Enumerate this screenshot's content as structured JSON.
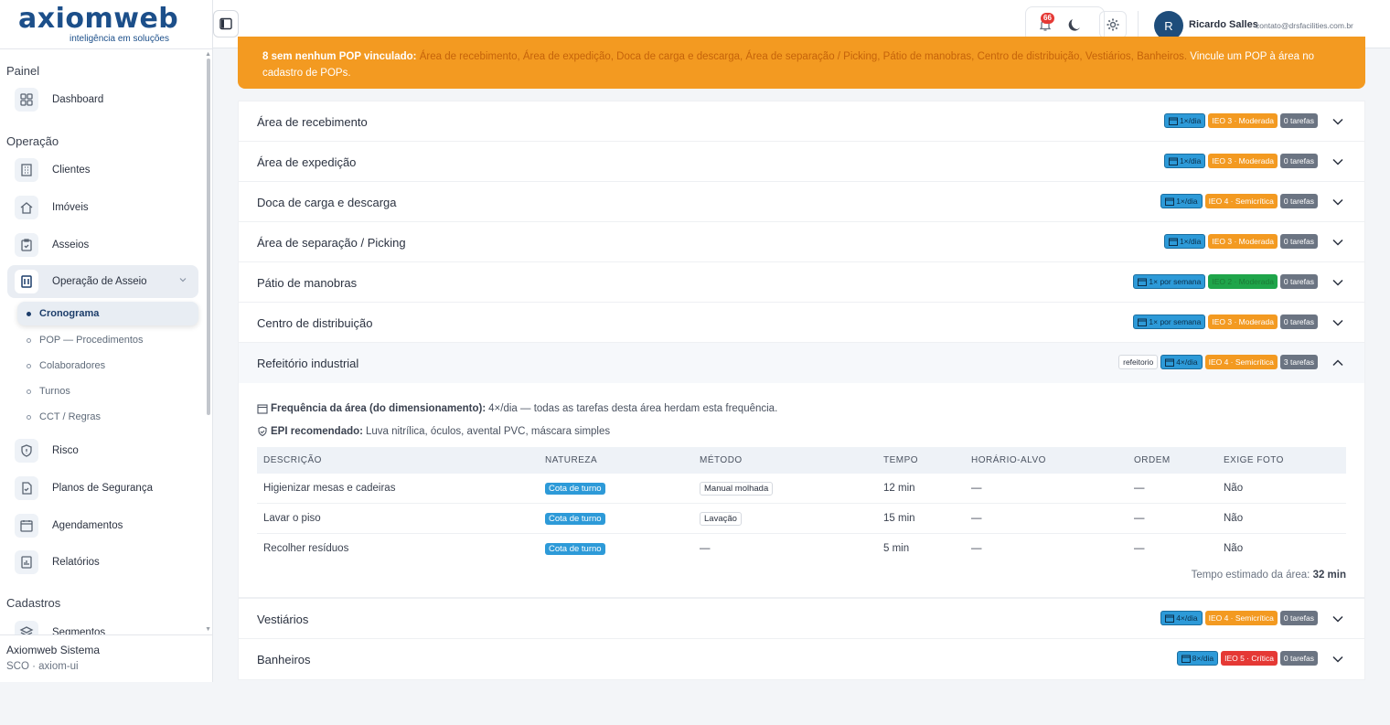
{
  "logo": {
    "main": "axiomweb",
    "tagline": "inteligência em soluções"
  },
  "sidebar": {
    "sections": [
      {
        "title": "Painel"
      },
      {
        "title": "Operação"
      },
      {
        "title": "Cadastros"
      }
    ],
    "items": {
      "dashboard": "Dashboard",
      "clientes": "Clientes",
      "imoveis": "Imóveis",
      "asseios": "Asseios",
      "operacao": "Operação de Asseio",
      "risco": "Risco",
      "planos": "Planos de Segurança",
      "agendamentos": "Agendamentos",
      "relatorios": "Relatórios",
      "segmentos": "Segmentos"
    },
    "sub_items": [
      "Cronograma",
      "POP — Procedimentos",
      "Colaboradores",
      "Turnos",
      "CCT / Regras"
    ],
    "footer": {
      "app": "Axiomweb Sistema",
      "info": "SCO · axiom-ui"
    }
  },
  "header": {
    "notif_count": "66",
    "user": {
      "initial": "R",
      "name": "Ricardo Salles",
      "email": "contato@drsfacilities.com.br"
    }
  },
  "alert": {
    "prefix": "8 sem nenhum POP vinculado:",
    "areas": "Área de recebimento, Área de expedição, Doca de carga e descarga, Área de separação / Picking, Pátio de manobras, Centro de distribuição, Vestiários, Banheiros.",
    "suffix": "Vincule um POP à área no cadastro de POPs."
  },
  "areas": [
    {
      "title": "Área de recebimento",
      "freq": "1×/dia",
      "ieo": "IEO 3 · Moderada",
      "tasks": "0 tarefas"
    },
    {
      "title": "Área de expedição",
      "freq": "1×/dia",
      "ieo": "IEO 3 · Moderada",
      "tasks": "0 tarefas"
    },
    {
      "title": "Doca de carga e descarga",
      "freq": "1×/dia",
      "ieo": "IEO 4 · Semicrítica",
      "tasks": "0 tarefas"
    },
    {
      "title": "Área de separação / Picking",
      "freq": "1×/dia",
      "ieo": "IEO 3 · Moderada",
      "tasks": "0 tarefas"
    },
    {
      "title": "Pátio de manobras",
      "freq": "1× por semana",
      "ieo": "IEO 2 · Moderada",
      "tasks": "0 tarefas"
    },
    {
      "title": "Centro de distribuição",
      "freq": "1× por semana",
      "ieo": "IEO 3 · Moderada",
      "tasks": "0 tarefas"
    },
    {
      "title": "Refeitório industrial",
      "tag": "refeitorio",
      "freq": "4×/dia",
      "ieo": "IEO 4 · Semicrítica",
      "tasks": "3 tarefas"
    },
    {
      "title": "Vestiários",
      "freq": "4×/dia",
      "ieo": "IEO 4 · Semicrítica",
      "tasks": "0 tarefas"
    },
    {
      "title": "Banheiros",
      "freq": "8×/dia",
      "ieo": "IEO 5 · Crítica",
      "tasks": "0 tarefas"
    }
  ],
  "expanded": {
    "freq_label": "Frequência da área (do dimensionamento):",
    "freq_text": "4×/dia — todas as tarefas desta área herdam esta frequência.",
    "epi_label": "EPI recomendado:",
    "epi_text": "Luva nitrílica, óculos, avental PVC, máscara simples",
    "columns": [
      "DESCRIÇÃO",
      "NATUREZA",
      "MÉTODO",
      "TEMPO",
      "HORÁRIO-ALVO",
      "ORDEM",
      "EXIGE FOTO"
    ],
    "rows": [
      {
        "desc": "Higienizar mesas e cadeiras",
        "natureza": "Cota de turno",
        "metodo": "Manual molhada",
        "tempo": "12 min",
        "horario": "—",
        "ordem": "—",
        "foto": "Não"
      },
      {
        "desc": "Lavar o piso",
        "natureza": "Cota de turno",
        "metodo": "Lavação",
        "tempo": "15 min",
        "horario": "—",
        "ordem": "—",
        "foto": "Não"
      },
      {
        "desc": "Recolher resíduos",
        "natureza": "Cota de turno",
        "metodo": "—",
        "tempo": "5 min",
        "horario": "—",
        "ordem": "—",
        "foto": "Não"
      }
    ],
    "total_label": "Tempo estimado da área:",
    "total_value": "32 min"
  },
  "colors": {
    "brand": "#1c4f8a",
    "alert": "#f39a21",
    "freq": "#2d9ad8",
    "critical": "#e53935",
    "low": "#1fa54a"
  }
}
